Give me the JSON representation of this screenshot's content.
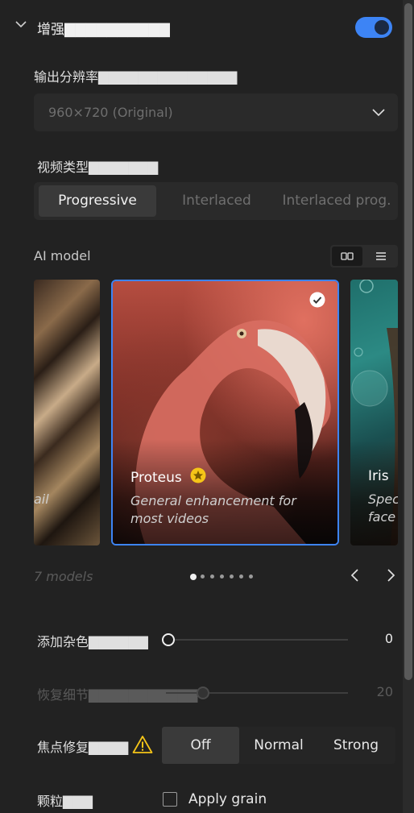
{
  "header": {
    "title": "增强▇▇▇▇▇▇▇▇▇▇",
    "enabled": true
  },
  "output_resolution": {
    "label": "输出分辨率▇▇▇▇▇▇▇▇▇▇▇▇▇▇",
    "value": "960×720 (Original)"
  },
  "video_type": {
    "label": "视频类型▇▇▇▇▇▇▇",
    "options": [
      "Progressive",
      "Interlaced",
      "Interlaced prog."
    ],
    "selected": "Progressive"
  },
  "ai_model": {
    "label": "AI model",
    "cards": [
      {
        "name": "",
        "desc": "ail"
      },
      {
        "name": "Proteus",
        "desc": "General enhancement for most videos",
        "selected": true
      },
      {
        "name": "Iris",
        "desc": "Spec face"
      }
    ],
    "count_label": "7 models",
    "page_index": 1,
    "page_count": 7
  },
  "sliders": [
    {
      "label": "添加杂色▇▇▇▇▇▇",
      "value": "0"
    },
    {
      "label": "恢复细节▇▇▇▇▇▇▇▇▇▇▇",
      "value": "20"
    }
  ],
  "focus_fix": {
    "label": "焦点修复▇▇▇▇",
    "options": [
      "Off",
      "Normal",
      "Strong"
    ],
    "selected": "Off"
  },
  "grain": {
    "label": "颗粒▇▇▇",
    "checkbox_label": "Apply grain",
    "checked": false
  },
  "colors": {
    "accent": "#3d84f5",
    "panel": "#222222",
    "gold": "#f5c518"
  }
}
